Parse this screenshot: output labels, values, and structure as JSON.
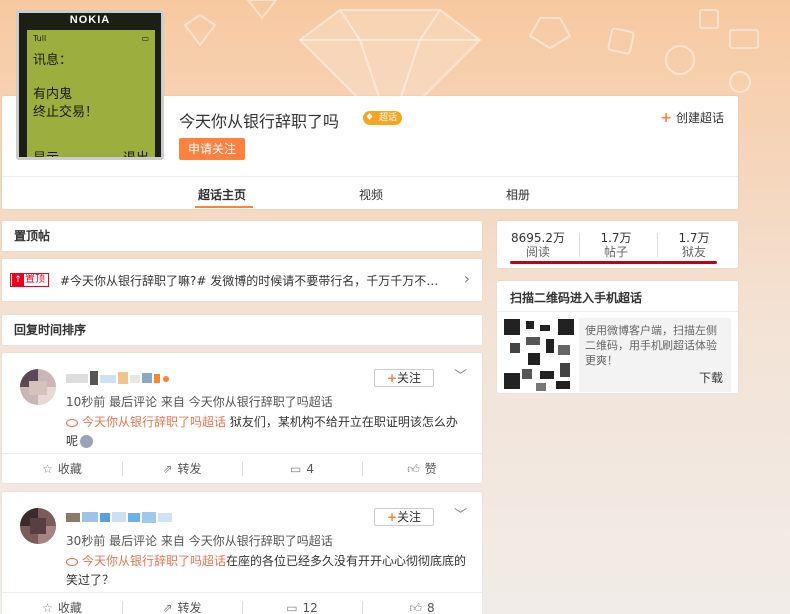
{
  "header": {
    "title": "今天你从银行辞职了吗",
    "badge": "超话",
    "follow_button": "申请关注",
    "create_label": "创建超话",
    "cover": {
      "brand": "NOKIA",
      "signal": "Tull",
      "line1": "讯息：",
      "line2": "有内鬼",
      "line3": "终止交易！",
      "soft_left": "显示",
      "soft_right": "退出"
    },
    "tabs": [
      {
        "label": "超话主页"
      },
      {
        "label": "视频"
      },
      {
        "label": "相册"
      }
    ]
  },
  "pinned": {
    "heading": "置顶帖",
    "tag": "置顶",
    "text": "#今天你从银行辞职了嘛?# 发微博的时候请不要带行名，千万千万不要…"
  },
  "sort_heading": "回复时间排序",
  "posts": [
    {
      "follow_label": "关注",
      "meta": "10秒前 最后评论 来自 今天你从银行辞职了吗超话",
      "topic": "今天你从银行辞职了吗超话",
      "content": " 狱友们，某机构不给开立在职证明该怎么办呢",
      "actions": {
        "fav": "收藏",
        "repost": "转发",
        "comment": "4",
        "like": "赞"
      }
    },
    {
      "follow_label": "关注",
      "meta": "30秒前 最后评论 来自 今天你从银行辞职了吗超话",
      "topic": "今天你从银行辞职了吗超话",
      "content": "在座的各位已经多久没有开开心心彻彻底底的笑过了？",
      "actions": {
        "fav": "收藏",
        "repost": "转发",
        "comment": "12",
        "like": "8"
      }
    }
  ],
  "stats": {
    "read": {
      "value": "8695.2万",
      "label": "阅读"
    },
    "posts": {
      "value": "1.7万",
      "label": "帖子"
    },
    "fans": {
      "value": "1.7万",
      "label": "狱友"
    }
  },
  "qr": {
    "title": "扫描二维码进入手机超话",
    "desc": "使用微博客户端，扫描左侧二维码，用手机刷超话体验更爽！",
    "download": "下载"
  },
  "colors": {
    "accent": "#ff8140",
    "topic": "#eb7350",
    "stat_underline": "#c2001a"
  }
}
